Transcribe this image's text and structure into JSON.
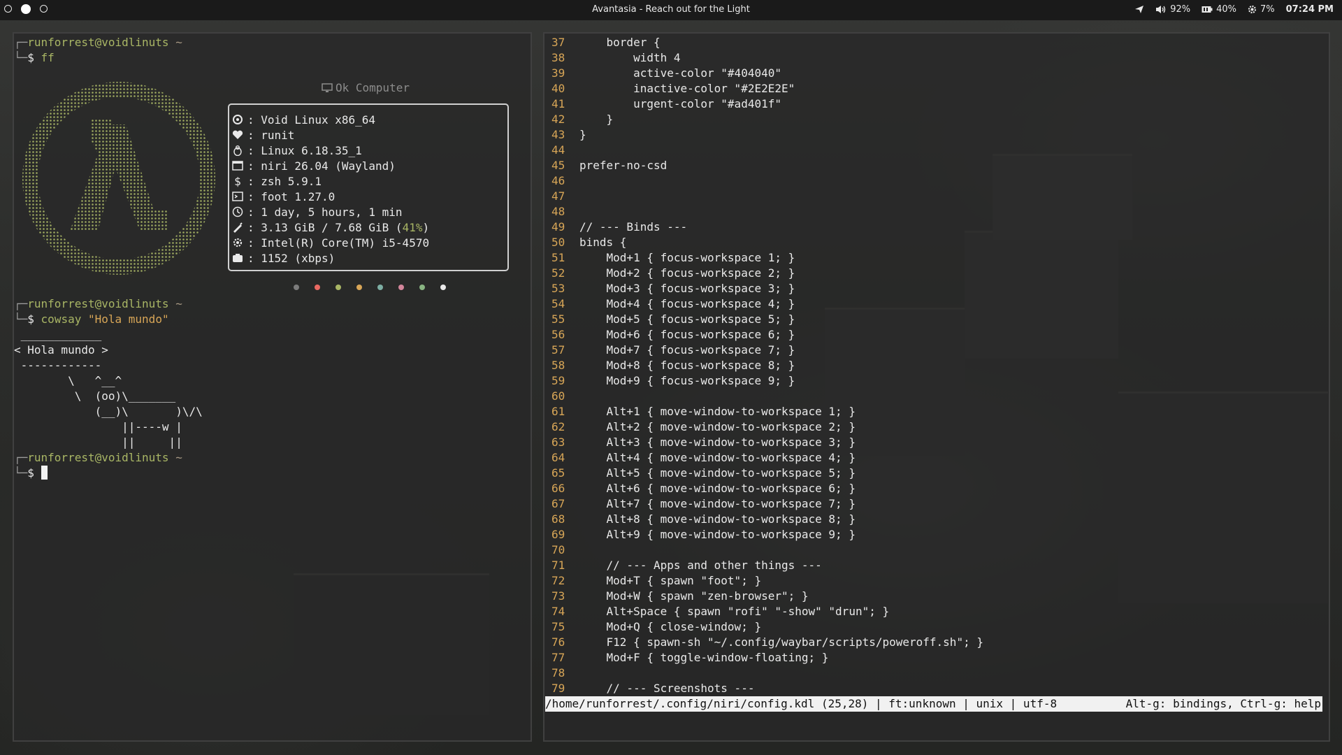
{
  "topbar": {
    "window_title": "Avantasia - Reach out for the Light",
    "workspaces": [
      "1",
      "2",
      "3"
    ],
    "volume": "92%",
    "battery": "40%",
    "cpu": "7%",
    "clock": "07:24 PM"
  },
  "terminal": {
    "prompt_user": "runforrest@voidlinuts",
    "prompt_dir": "~",
    "prompt_symbol": "$",
    "cmd1": "ff",
    "cmd2_name": "cowsay",
    "cmd2_arg": "\"Hola mundo\"",
    "cowsay": [
      " ____________",
      "< Hola mundo >",
      " ------------",
      "        \\   ^__^",
      "         \\  (oo)\\_______",
      "            (__)\\       )\\/\\",
      "                ||----w |",
      "                ||     ||"
    ],
    "fastfetch": {
      "title": "Ok Computer",
      "rows": [
        {
          "icon": "void-icon",
          "text": "Void Linux x86_64"
        },
        {
          "icon": "heart-icon",
          "text": "runit"
        },
        {
          "icon": "penguin-icon",
          "text": "Linux 6.18.35_1"
        },
        {
          "icon": "window-icon",
          "text": "niri 26.04 (Wayland)"
        },
        {
          "icon": "dollar-icon",
          "text": "zsh 5.9.1"
        },
        {
          "icon": "terminal-icon",
          "text": "foot 1.27.0"
        },
        {
          "icon": "clock-icon",
          "text": "1 day, 5 hours, 1 min"
        },
        {
          "icon": "memory-icon",
          "text": "3.13 GiB / 7.68 GiB (",
          "extra": "41%",
          "extra_end": ")"
        },
        {
          "icon": "cpu-icon",
          "text": "Intel(R) Core(TM) i5-4570"
        },
        {
          "icon": "package-icon",
          "text": "1152 (xbps)"
        }
      ],
      "palette": [
        "#7c7c7c",
        "#ea6962",
        "#a9b665",
        "#d8a657",
        "#7daea3",
        "#d3869b",
        "#89b482",
        "#e9e9e9"
      ]
    }
  },
  "editor": {
    "lines": [
      {
        "n": "37",
        "t": "    border {"
      },
      {
        "n": "38",
        "t": "        width 4"
      },
      {
        "n": "39",
        "t": "        active-color \"#404040\""
      },
      {
        "n": "40",
        "t": "        inactive-color \"#2E2E2E\""
      },
      {
        "n": "41",
        "t": "        urgent-color \"#ad401f\""
      },
      {
        "n": "42",
        "t": "    }"
      },
      {
        "n": "43",
        "t": "}"
      },
      {
        "n": "44",
        "t": ""
      },
      {
        "n": "45",
        "t": "prefer-no-csd"
      },
      {
        "n": "46",
        "t": ""
      },
      {
        "n": "47",
        "t": ""
      },
      {
        "n": "48",
        "t": ""
      },
      {
        "n": "49",
        "t": "// --- Binds ---"
      },
      {
        "n": "50",
        "t": "binds {"
      },
      {
        "n": "51",
        "t": "    Mod+1 { focus-workspace 1; }"
      },
      {
        "n": "52",
        "t": "    Mod+2 { focus-workspace 2; }"
      },
      {
        "n": "53",
        "t": "    Mod+3 { focus-workspace 3; }"
      },
      {
        "n": "54",
        "t": "    Mod+4 { focus-workspace 4; }"
      },
      {
        "n": "55",
        "t": "    Mod+5 { focus-workspace 5; }"
      },
      {
        "n": "56",
        "t": "    Mod+6 { focus-workspace 6; }"
      },
      {
        "n": "57",
        "t": "    Mod+7 { focus-workspace 7; }"
      },
      {
        "n": "58",
        "t": "    Mod+8 { focus-workspace 8; }"
      },
      {
        "n": "59",
        "t": "    Mod+9 { focus-workspace 9; }"
      },
      {
        "n": "60",
        "t": ""
      },
      {
        "n": "61",
        "t": "    Alt+1 { move-window-to-workspace 1; }"
      },
      {
        "n": "62",
        "t": "    Alt+2 { move-window-to-workspace 2; }"
      },
      {
        "n": "63",
        "t": "    Alt+3 { move-window-to-workspace 3; }"
      },
      {
        "n": "64",
        "t": "    Alt+4 { move-window-to-workspace 4; }"
      },
      {
        "n": "65",
        "t": "    Alt+5 { move-window-to-workspace 5; }"
      },
      {
        "n": "66",
        "t": "    Alt+6 { move-window-to-workspace 6; }"
      },
      {
        "n": "67",
        "t": "    Alt+7 { move-window-to-workspace 7; }"
      },
      {
        "n": "68",
        "t": "    Alt+8 { move-window-to-workspace 8; }"
      },
      {
        "n": "69",
        "t": "    Alt+9 { move-window-to-workspace 9; }"
      },
      {
        "n": "70",
        "t": ""
      },
      {
        "n": "71",
        "t": "    // --- Apps and other things ---"
      },
      {
        "n": "72",
        "t": "    Mod+T { spawn \"foot\"; }"
      },
      {
        "n": "73",
        "t": "    Mod+W { spawn \"zen-browser\"; }"
      },
      {
        "n": "74",
        "t": "    Alt+Space { spawn \"rofi\" \"-show\" \"drun\"; }"
      },
      {
        "n": "75",
        "t": "    Mod+Q { close-window; }"
      },
      {
        "n": "76",
        "t": "    F12 { spawn-sh \"~/.config/waybar/scripts/poweroff.sh\"; }"
      },
      {
        "n": "77",
        "t": "    Mod+F { toggle-window-floating; }"
      },
      {
        "n": "78",
        "t": ""
      },
      {
        "n": "79",
        "t": "    // --- Screenshots ---"
      }
    ],
    "status_left": "/home/runforrest/.config/niri/config.kdl (25,28) | ft:unknown | unix | utf-8",
    "status_right": "Alt-g: bindings, Ctrl-g: help"
  }
}
